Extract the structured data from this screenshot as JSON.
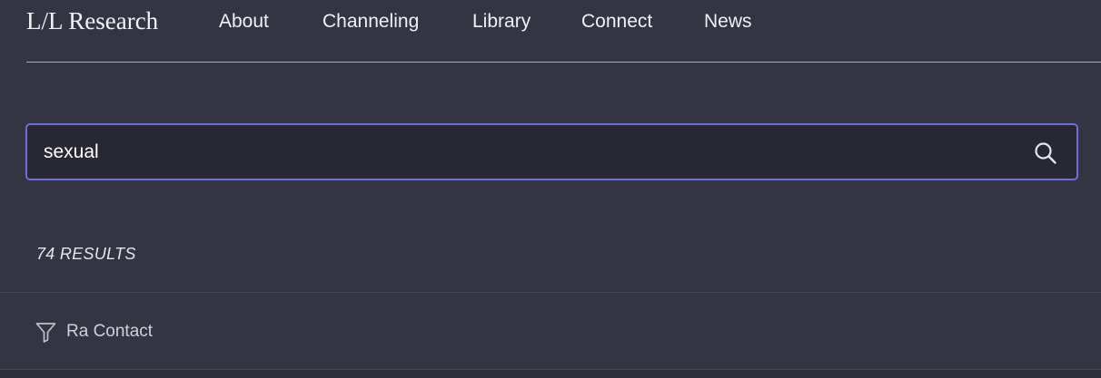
{
  "header": {
    "brand": "L/L Research",
    "nav": [
      {
        "label": "About"
      },
      {
        "label": "Channeling"
      },
      {
        "label": "Library"
      },
      {
        "label": "Connect"
      },
      {
        "label": "News"
      }
    ]
  },
  "search": {
    "value": "sexual",
    "icon": "search-icon"
  },
  "results": {
    "count_label": "74 RESULTS"
  },
  "filter": {
    "icon": "filter-icon",
    "label": "Ra Contact"
  },
  "colors": {
    "background": "#333542",
    "input_background": "#272833",
    "focus_border": "#6d6ddf",
    "divider": "#a8a9b3"
  }
}
